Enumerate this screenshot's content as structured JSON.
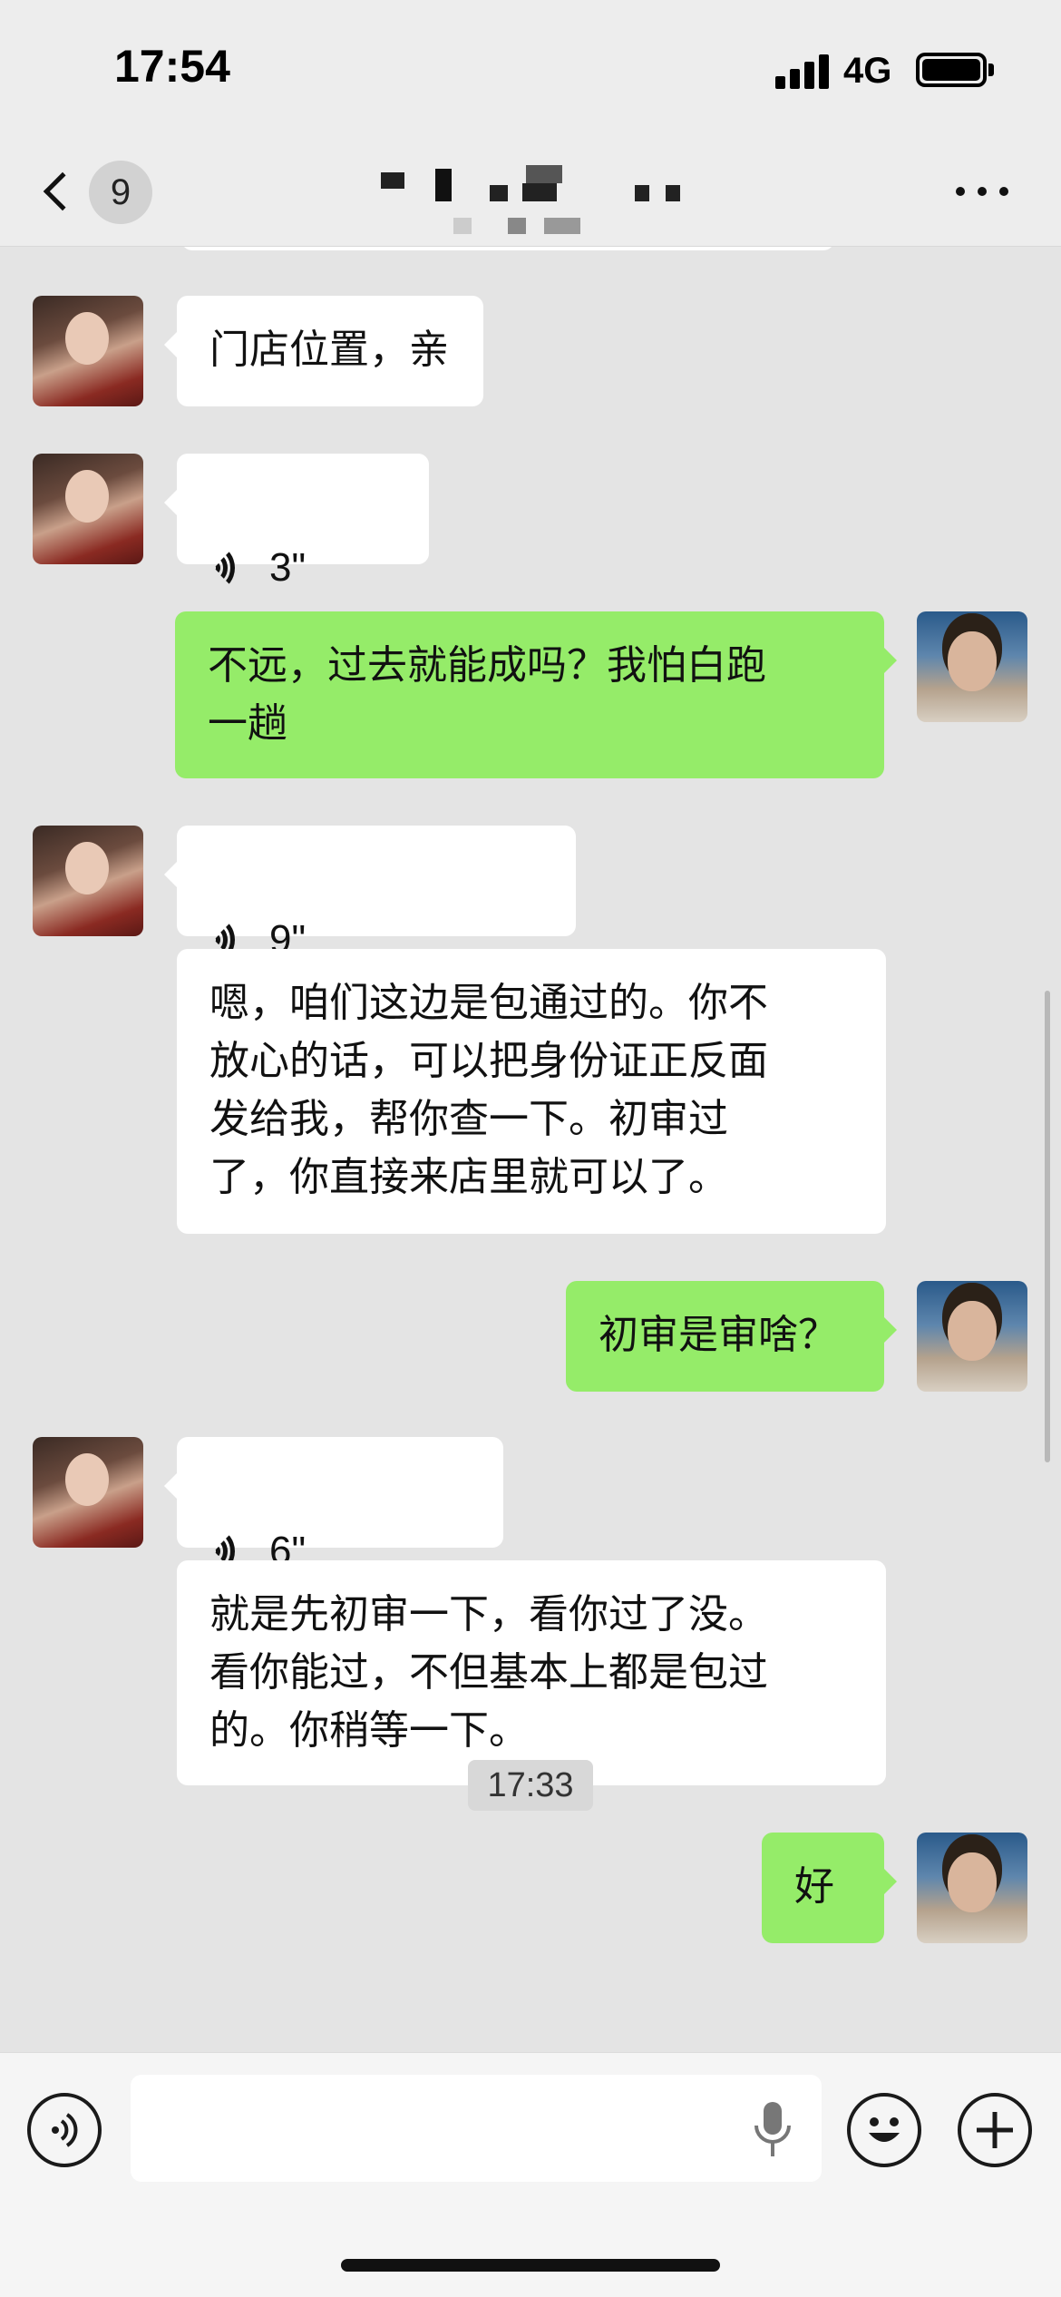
{
  "status_bar": {
    "time": "17:54",
    "network": "4G"
  },
  "nav": {
    "unread_count": "9"
  },
  "messages": [
    {
      "side": "in",
      "type": "text",
      "text": "门店位置，亲"
    },
    {
      "side": "in",
      "type": "voice",
      "duration": "3\""
    },
    {
      "side": "out",
      "type": "text",
      "text": "不远，过去就能成吗？我怕白跑\n一趟"
    },
    {
      "side": "in",
      "type": "voice",
      "duration": "9\""
    },
    {
      "side": "in",
      "type": "text",
      "text": "嗯，咱们这边是包通过的。你不\n放心的话，可以把身份证正反面\n发给我，帮你查一下。初审过\n了，你直接来店里就可以了。"
    },
    {
      "side": "out",
      "type": "text",
      "text": "初审是审啥？"
    },
    {
      "side": "in",
      "type": "voice",
      "duration": "6\""
    },
    {
      "side": "in",
      "type": "text",
      "text": "就是先初审一下，看你过了没。\n看你能过，不但基本上都是包过\n的。你稍等一下。"
    },
    {
      "side": "out",
      "type": "text",
      "text": "好"
    }
  ],
  "timestamp": "17:33",
  "input": {
    "value": ""
  },
  "icons": {
    "back": "chevron-left-icon",
    "more": "more-dots-icon",
    "voice_toggle": "voice-mode-icon",
    "mic": "microphone-icon",
    "emoji": "emoji-icon",
    "plus": "plus-icon"
  },
  "colors": {
    "outgoing_bubble": "#95ec69",
    "incoming_bubble": "#ffffff",
    "chat_background": "#e4e4e4"
  }
}
